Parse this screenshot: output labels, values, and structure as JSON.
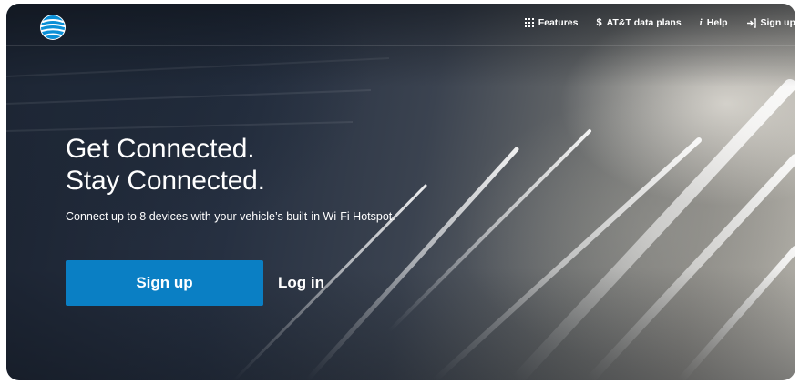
{
  "brand": {
    "logo_icon": "att-globe-icon",
    "color": "#0a7fc4"
  },
  "nav": {
    "items": [
      {
        "label": "Features",
        "icon": "grid-icon"
      },
      {
        "label": "AT&T data plans",
        "icon": "dollar-icon"
      },
      {
        "label": "Help",
        "icon": "info-icon"
      },
      {
        "label": "Sign up",
        "icon": "sign-in-icon"
      }
    ]
  },
  "hero": {
    "title_line1": "Get Connected.",
    "title_line2": "Stay Connected.",
    "subtitle": "Connect up to 8 devices with your vehicle’s built-in Wi-Fi Hotspot.",
    "signup_label": "Sign up",
    "login_label": "Log in"
  }
}
